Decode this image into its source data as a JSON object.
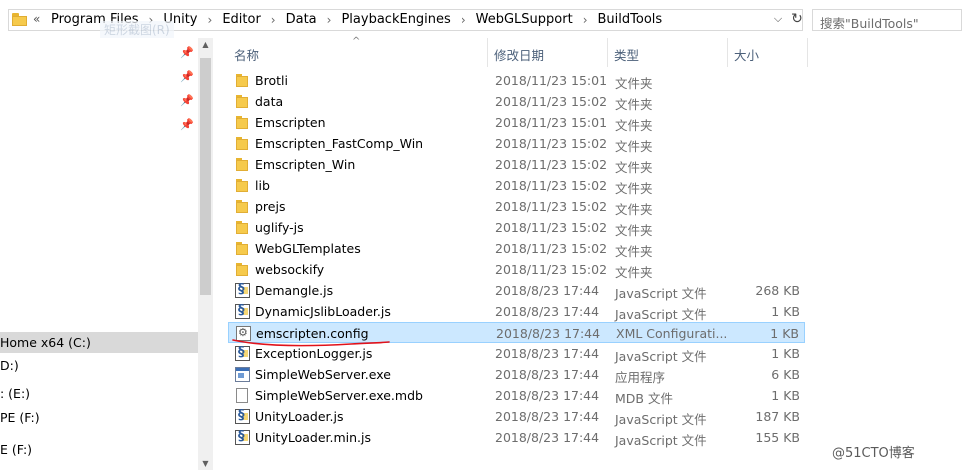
{
  "address": {
    "overflow": "«",
    "crumbs": [
      "Program Files",
      "Unity",
      "Editor",
      "Data",
      "PlaybackEngines",
      "WebGLSupport",
      "BuildTools"
    ],
    "dropdown_icon": "chevron-down",
    "refresh_icon": "refresh"
  },
  "search": {
    "placeholder": "搜索\"BuildTools\""
  },
  "nav": {
    "ghost": "矩形截图(R)",
    "items": [
      {
        "label": "Home x64 (C:)",
        "selected": true
      },
      {
        "label": "D:)"
      },
      {
        "label": ": (E:)"
      },
      {
        "label": "PE (F:)"
      },
      {
        "label": "E (F:)"
      }
    ]
  },
  "columns": {
    "name": "名称",
    "date": "修改日期",
    "type": "类型",
    "size": "大小"
  },
  "files": [
    {
      "name": "Brotli",
      "date": "2018/11/23 15:01",
      "type": "文件夹",
      "size": "",
      "icon": "folder"
    },
    {
      "name": "data",
      "date": "2018/11/23 15:02",
      "type": "文件夹",
      "size": "",
      "icon": "folder"
    },
    {
      "name": "Emscripten",
      "date": "2018/11/23 15:01",
      "type": "文件夹",
      "size": "",
      "icon": "folder"
    },
    {
      "name": "Emscripten_FastComp_Win",
      "date": "2018/11/23 15:02",
      "type": "文件夹",
      "size": "",
      "icon": "folder"
    },
    {
      "name": "Emscripten_Win",
      "date": "2018/11/23 15:02",
      "type": "文件夹",
      "size": "",
      "icon": "folder"
    },
    {
      "name": "lib",
      "date": "2018/11/23 15:02",
      "type": "文件夹",
      "size": "",
      "icon": "folder"
    },
    {
      "name": "prejs",
      "date": "2018/11/23 15:02",
      "type": "文件夹",
      "size": "",
      "icon": "folder"
    },
    {
      "name": "uglify-js",
      "date": "2018/11/23 15:02",
      "type": "文件夹",
      "size": "",
      "icon": "folder"
    },
    {
      "name": "WebGLTemplates",
      "date": "2018/11/23 15:02",
      "type": "文件夹",
      "size": "",
      "icon": "folder"
    },
    {
      "name": "websockify",
      "date": "2018/11/23 15:02",
      "type": "文件夹",
      "size": "",
      "icon": "folder"
    },
    {
      "name": "Demangle.js",
      "date": "2018/8/23 17:44",
      "type": "JavaScript 文件",
      "size": "268 KB",
      "icon": "js"
    },
    {
      "name": "DynamicJslibLoader.js",
      "date": "2018/8/23 17:44",
      "type": "JavaScript 文件",
      "size": "1 KB",
      "icon": "js"
    },
    {
      "name": "emscripten.config",
      "date": "2018/8/23 17:44",
      "type": "XML Configurati...",
      "size": "1 KB",
      "icon": "config",
      "selected": true
    },
    {
      "name": "ExceptionLogger.js",
      "date": "2018/8/23 17:44",
      "type": "JavaScript 文件",
      "size": "1 KB",
      "icon": "js"
    },
    {
      "name": "SimpleWebServer.exe",
      "date": "2018/8/23 17:44",
      "type": "应用程序",
      "size": "6 KB",
      "icon": "exe"
    },
    {
      "name": "SimpleWebServer.exe.mdb",
      "date": "2018/8/23 17:44",
      "type": "MDB 文件",
      "size": "1 KB",
      "icon": "file"
    },
    {
      "name": "UnityLoader.js",
      "date": "2018/8/23 17:44",
      "type": "JavaScript 文件",
      "size": "187 KB",
      "icon": "js"
    },
    {
      "name": "UnityLoader.min.js",
      "date": "2018/8/23 17:44",
      "type": "JavaScript 文件",
      "size": "155 KB",
      "icon": "js"
    }
  ],
  "annotation_color": "#e0121b",
  "watermark": "@51CTO博客"
}
